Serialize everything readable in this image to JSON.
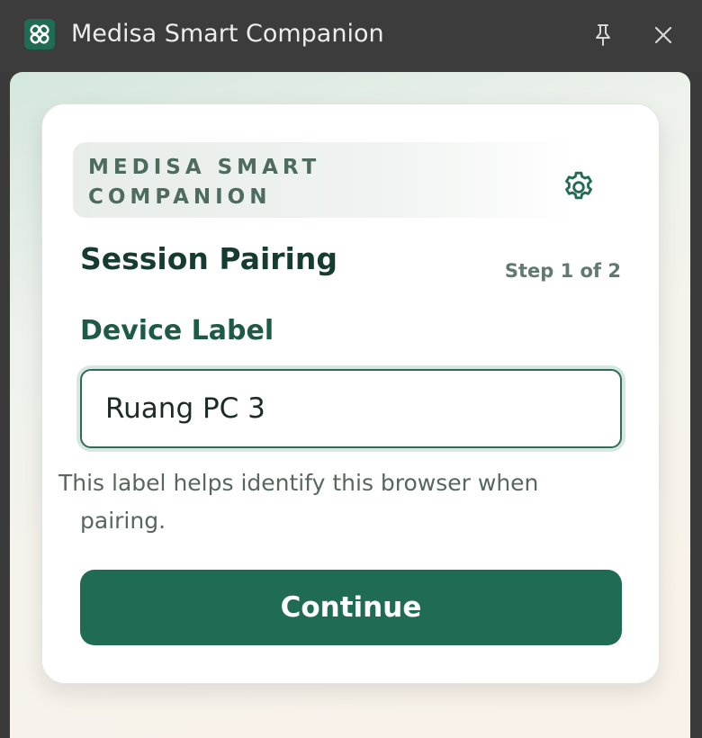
{
  "window": {
    "title": "Medisa Smart Companion",
    "logo_icon": "medisa-logo-icon",
    "pin_icon": "pin-icon",
    "close_icon": "close-icon"
  },
  "card": {
    "brand_line1": "MEDISA SMART",
    "brand_line2": "COMPANION",
    "settings_icon": "gear-icon",
    "section_title": "Session Pairing",
    "step_text": "Step 1 of 2",
    "field_label": "Device Label",
    "device_label_value": "Ruang PC 3",
    "helper_line1": "This label helps identify this browser when",
    "helper_line2": "pairing.",
    "continue_label": "Continue"
  },
  "colors": {
    "accent": "#1f6b54",
    "titlebar": "#3c3c3c",
    "heading": "#163c31"
  }
}
